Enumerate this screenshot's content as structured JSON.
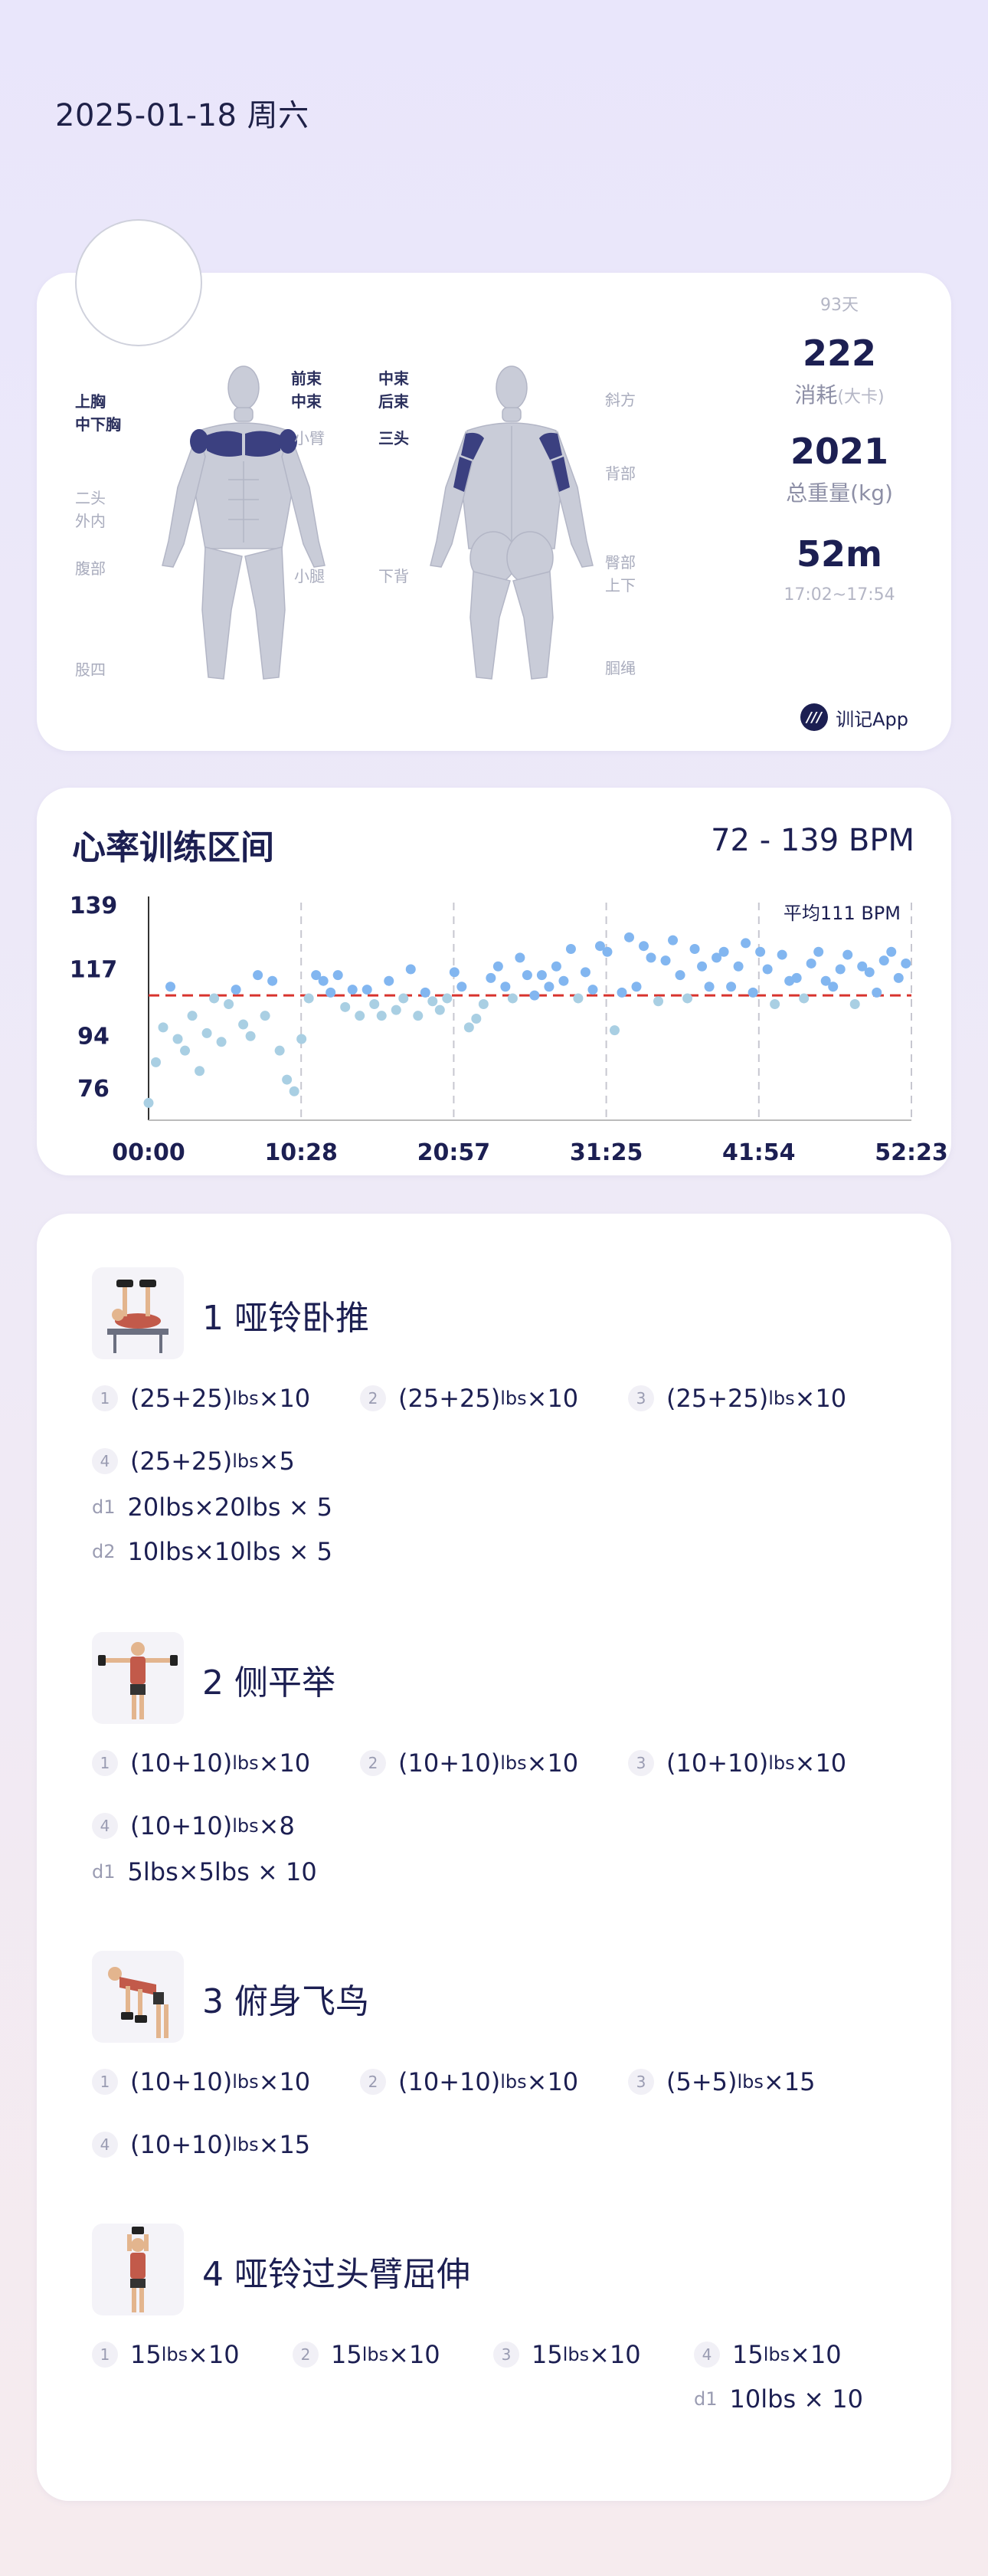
{
  "date": "2025-01-18 周六",
  "summary": {
    "days": "93天",
    "calories": "222",
    "calories_label": "消耗",
    "calories_unit": "(大卡)",
    "weight": "2021",
    "weight_label": "总重量(kg)",
    "duration": "52m",
    "time_range": "17:02~17:54",
    "brand": "训记App",
    "front_labels_left": [
      "上胸",
      "中下胸",
      "二头",
      "外内",
      "腹部",
      "股四"
    ],
    "front_labels_right": [
      "前束",
      "中束",
      "小臂",
      "小腿"
    ],
    "back_labels_left": [
      "中束",
      "后束",
      "三头",
      "下背"
    ],
    "back_labels_right": [
      "斜方",
      "背部",
      "臀部",
      "上下",
      "腘绳"
    ]
  },
  "heart": {
    "title": "心率训练区间",
    "range": "72 - 139 BPM",
    "avg_label": "平均111 BPM"
  },
  "chart_data": {
    "type": "scatter",
    "title": "心率训练区间",
    "x_ticks": [
      "00:00",
      "10:28",
      "20:57",
      "31:25",
      "41:54",
      "52:23"
    ],
    "y_ticks": [
      "139",
      "117",
      "94",
      "76"
    ],
    "ylim": [
      72,
      139
    ],
    "xlim_minutes": [
      0,
      52.38
    ],
    "average": 111,
    "average_label": "平均111 BPM",
    "series": [
      {
        "x": [
          0,
          0.5,
          1,
          1.5,
          2,
          2.5,
          3,
          3.5,
          4,
          4.5,
          5,
          5.5,
          6,
          6.5,
          7,
          7.5,
          8,
          8.5,
          9,
          9.5,
          10,
          10.5,
          11,
          11.5,
          12,
          12.5,
          13,
          13.5,
          14,
          14.5,
          15,
          15.5,
          16,
          16.5,
          17,
          17.5,
          18,
          18.5,
          19,
          19.5,
          20,
          20.5,
          21,
          21.5,
          22,
          22.5,
          23,
          23.5,
          24,
          24.5,
          25,
          25.5,
          26,
          26.5,
          27,
          27.5,
          28,
          28.5,
          29,
          29.5,
          30,
          30.5,
          31,
          31.5,
          32,
          32.5,
          33,
          33.5,
          34,
          34.5,
          35,
          35.5,
          36,
          36.5,
          37,
          37.5,
          38,
          38.5,
          39,
          39.5,
          40,
          40.5,
          41,
          41.5,
          42,
          42.5,
          43,
          43.5,
          44,
          44.5,
          45,
          45.5,
          46,
          46.5,
          47,
          47.5,
          48,
          48.5,
          49,
          49.5,
          50,
          50.5,
          51,
          51.5,
          52
        ],
        "values": [
          74,
          88,
          100,
          114,
          96,
          92,
          104,
          85,
          98,
          110,
          95,
          108,
          113,
          101,
          97,
          118,
          104,
          116,
          92,
          82,
          78,
          96,
          110,
          118,
          116,
          112,
          118,
          107,
          113,
          104,
          113,
          108,
          104,
          116,
          106,
          110,
          120,
          104,
          112,
          109,
          106,
          110,
          119,
          114,
          100,
          103,
          108,
          117,
          121,
          114,
          110,
          124,
          118,
          111,
          118,
          114,
          121,
          116,
          127,
          110,
          119,
          113,
          128,
          126,
          99,
          112,
          131,
          114,
          128,
          124,
          109,
          123,
          130,
          118,
          110,
          127,
          121,
          114,
          124,
          126,
          114,
          121,
          129,
          112,
          126,
          120,
          108,
          125,
          116,
          117,
          110,
          122,
          126,
          116,
          114,
          120,
          125,
          108,
          121,
          119,
          112,
          123,
          126,
          117,
          122
        ]
      }
    ]
  },
  "exercises": [
    {
      "title": "1 哑铃卧推",
      "sets": [
        {
          "idx": "1",
          "text": "(25+25)",
          "unit": "lbs",
          "reps": "×10"
        },
        {
          "idx": "2",
          "text": "(25+25)",
          "unit": "lbs",
          "reps": "×10"
        },
        {
          "idx": "3",
          "text": "(25+25)",
          "unit": "lbs",
          "reps": "×10"
        },
        {
          "idx": "4",
          "text": "(25+25)",
          "unit": "lbs",
          "reps": "×5"
        },
        {
          "idx": "d1",
          "text": "20lbs×20lbs × 5"
        },
        {
          "idx": "d2",
          "text": "10lbs×10lbs × 5"
        }
      ]
    },
    {
      "title": "2 侧平举",
      "sets": [
        {
          "idx": "1",
          "text": "(10+10)",
          "unit": "lbs",
          "reps": "×10"
        },
        {
          "idx": "2",
          "text": "(10+10)",
          "unit": "lbs",
          "reps": "×10"
        },
        {
          "idx": "3",
          "text": "(10+10)",
          "unit": "lbs",
          "reps": "×10"
        },
        {
          "idx": "4",
          "text": "(10+10)",
          "unit": "lbs",
          "reps": "×8"
        },
        {
          "idx": "d1",
          "text": "5lbs×5lbs × 10"
        }
      ]
    },
    {
      "title": "3 俯身飞鸟",
      "sets": [
        {
          "idx": "1",
          "text": "(10+10)",
          "unit": "lbs",
          "reps": "×10"
        },
        {
          "idx": "2",
          "text": "(10+10)",
          "unit": "lbs",
          "reps": "×10"
        },
        {
          "idx": "3",
          "text": "(5+5)",
          "unit": "lbs",
          "reps": "×15"
        },
        {
          "idx": "4",
          "text": "(10+10)",
          "unit": "lbs",
          "reps": "×15"
        }
      ]
    },
    {
      "title": "4 哑铃过头臂屈伸",
      "sets": [
        {
          "idx": "1",
          "text": "15",
          "unit": "lbs",
          "reps": "×10"
        },
        {
          "idx": "2",
          "text": "15",
          "unit": "lbs",
          "reps": "×10"
        },
        {
          "idx": "3",
          "text": "15",
          "unit": "lbs",
          "reps": "×10"
        },
        {
          "idx": "4",
          "text": "15",
          "unit": "lbs",
          "reps": "×10"
        },
        {
          "idx": "d1",
          "text": "10lbs × 10"
        }
      ]
    }
  ],
  "colors": {
    "accent": "#1c1f52",
    "muscle_active": "#3b4080",
    "muscle_idle": "#c9ccd8",
    "point_high": "#82b6f0",
    "point_low": "#a9cfe3",
    "avg_line": "#d8332d"
  }
}
